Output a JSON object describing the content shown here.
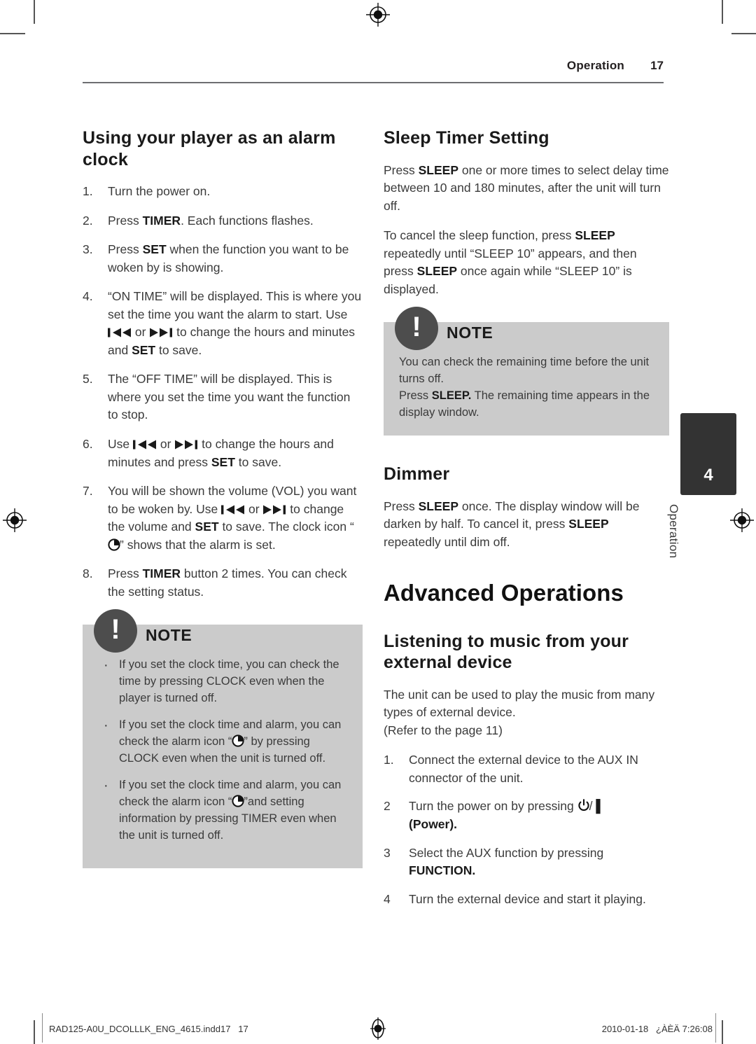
{
  "header": {
    "section": "Operation",
    "page_number": "17"
  },
  "side_tab": {
    "number": "4",
    "label": "Operation"
  },
  "left_column": {
    "heading": "Using your player as an alarm clock",
    "steps": [
      {
        "num": "1.",
        "parts": [
          {
            "t": "Turn the power on."
          }
        ]
      },
      {
        "num": "2.",
        "parts": [
          {
            "t": "Press "
          },
          {
            "t": "TIMER",
            "b": true
          },
          {
            "t": ". Each functions flashes."
          }
        ]
      },
      {
        "num": "3.",
        "parts": [
          {
            "t": "Press "
          },
          {
            "t": "SET",
            "b": true
          },
          {
            "t": " when the function you want to be woken by is showing."
          }
        ]
      },
      {
        "num": "4.",
        "parts": [
          {
            "t": "“ON TIME” will be displayed. This is where you set the time you want the alarm to start. Use "
          },
          {
            "icon": "skip-back-icon"
          },
          {
            "t": " or "
          },
          {
            "icon": "skip-forward-icon"
          },
          {
            "t": " to change the hours and minutes and "
          },
          {
            "t": "SET",
            "b": true
          },
          {
            "t": " to save."
          }
        ]
      },
      {
        "num": "5.",
        "parts": [
          {
            "t": "The “OFF TIME” will be displayed. This is where you set the time you want the function to stop."
          }
        ]
      },
      {
        "num": "6.",
        "parts": [
          {
            "t": "Use "
          },
          {
            "icon": "skip-back-icon"
          },
          {
            "t": " or "
          },
          {
            "icon": "skip-forward-icon"
          },
          {
            "t": " to change the hours and minutes and press "
          },
          {
            "t": "SET",
            "b": true
          },
          {
            "t": " to save."
          }
        ]
      },
      {
        "num": "7.",
        "parts": [
          {
            "t": "You will be shown the volume (VOL) you want to be woken by. Use "
          },
          {
            "icon": "skip-back-icon"
          },
          {
            "t": " or "
          },
          {
            "icon": "skip-forward-icon"
          },
          {
            "t": " to change the volume and "
          },
          {
            "t": "SET",
            "b": true
          },
          {
            "t": " to save. The clock icon “"
          },
          {
            "icon": "clock-icon"
          },
          {
            "t": "” shows that the alarm is set."
          }
        ]
      },
      {
        "num": "8.",
        "parts": [
          {
            "t": "Press "
          },
          {
            "t": "TIMER",
            "b": true
          },
          {
            "t": " button 2 times. You can check the setting status."
          }
        ]
      }
    ],
    "note": {
      "title": "NOTE",
      "bullets": [
        [
          {
            "t": "If you set the clock time, you can check the time by pressing CLOCK even when the player is turned off."
          }
        ],
        [
          {
            "t": "If you set the clock time and alarm, you can check the alarm icon “"
          },
          {
            "icon": "clock-icon"
          },
          {
            "t": "” by pressing CLOCK even when the unit is turned off."
          }
        ],
        [
          {
            "t": "If you set the clock time and alarm, you can check the alarm icon “"
          },
          {
            "icon": "clock-icon"
          },
          {
            "t": "”and setting information by pressing TIMER even when the unit is turned off."
          }
        ]
      ]
    }
  },
  "right_column": {
    "sleep_timer": {
      "heading": "Sleep Timer Setting",
      "paragraphs": [
        [
          {
            "t": "Press "
          },
          {
            "t": "SLEEP",
            "b": true
          },
          {
            "t": " one or more times to select delay time between 10 and 180 minutes, after the unit will turn off."
          }
        ],
        [
          {
            "t": "To cancel the sleep function, press "
          },
          {
            "t": "SLEEP",
            "b": true
          },
          {
            "t": " repeatedly until “SLEEP 10” appears, and then press "
          },
          {
            "t": "SLEEP",
            "b": true
          },
          {
            "t": " once again while “SLEEP 10” is displayed."
          }
        ]
      ],
      "note": {
        "title": "NOTE",
        "paragraph": [
          {
            "t": "You can check the remaining time before the unit turns off."
          },
          {
            "br": true
          },
          {
            "t": "Press "
          },
          {
            "t": "SLEEP.",
            "b": true
          },
          {
            "t": " The remaining time appears in the display window."
          }
        ]
      }
    },
    "dimmer": {
      "heading": "Dimmer",
      "paragraph": [
        {
          "t": "Press "
        },
        {
          "t": "SLEEP",
          "b": true
        },
        {
          "t": " once. The display window will be darken by half. To cancel it, press "
        },
        {
          "t": "SLEEP",
          "b": true
        },
        {
          "t": " repeatedly until dim off."
        }
      ]
    },
    "chapter_title": "Advanced Operations",
    "external_device": {
      "heading": "Listening to music from your external device",
      "paragraph": [
        {
          "t": "The unit can be used to play the music from many types of external device."
        },
        {
          "br": true
        },
        {
          "t": "(Refer to the page 11)"
        }
      ],
      "steps": [
        {
          "num": "1.",
          "parts": [
            {
              "t": "Connect the external device to the AUX IN connector of the unit."
            }
          ]
        },
        {
          "num": "2",
          "parts": [
            {
              "t": "Turn the power on by pressing "
            },
            {
              "icon": "power-icon"
            },
            {
              "t": "/ "
            },
            {
              "t": "▌",
              "b": true
            },
            {
              "br": true
            },
            {
              "t": "(Power).",
              "b": true
            }
          ]
        },
        {
          "num": "3",
          "parts": [
            {
              "t": "Select the AUX function by pressing "
            },
            {
              "br": true
            },
            {
              "t": "FUNCTION.",
              "b": true
            }
          ]
        },
        {
          "num": "4",
          "parts": [
            {
              "t": "Turn the external device and start it playing."
            }
          ]
        }
      ]
    }
  },
  "footer": {
    "left": "RAD125-A0U_DCOLLLK_ENG_4615.indd17   17",
    "right": "2010-01-18   ¿ÀÈÄ 7:26:08"
  }
}
